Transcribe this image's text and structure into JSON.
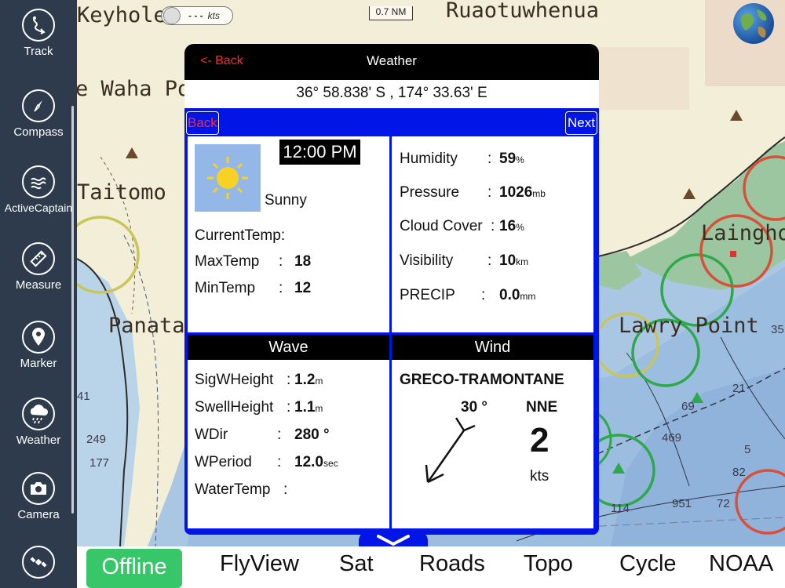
{
  "sidebar": {
    "items": [
      {
        "label": "Track",
        "icon": "track-icon"
      },
      {
        "label": "Compass",
        "icon": "compass-icon"
      },
      {
        "label": "ActiveCaptain",
        "icon": "activecaptain-icon"
      },
      {
        "label": "Measure",
        "icon": "ruler-icon"
      },
      {
        "label": "Marker",
        "icon": "map-pin-icon"
      },
      {
        "label": "Weather",
        "icon": "cloud-rain-icon"
      },
      {
        "label": "Camera",
        "icon": "camera-icon"
      },
      {
        "label": "",
        "icon": "satellite-icon"
      }
    ]
  },
  "map": {
    "place_labels": [
      "Keyhole",
      "Ruaotuwhenua",
      "e Waha Po",
      "Taitomo",
      "Panata",
      "Laingho",
      "Lawry Point"
    ],
    "depths": [
      "21",
      "69",
      "469",
      "5",
      "82",
      "114",
      "951",
      "72",
      "41",
      "249",
      "177",
      "35"
    ],
    "speed": {
      "value": "- - -",
      "unit": "kts"
    },
    "scale": "0.7 NM"
  },
  "dialog": {
    "back_label": "<- Back",
    "title": "Weather",
    "coordinates": "36° 58.838' S , 174° 33.63' E",
    "nav_back": "Back",
    "nav_next": "Next",
    "current": {
      "time": "12:00 PM",
      "condition": "Sunny",
      "condition_icon": "sun-icon",
      "current_temp_label": "CurrentTemp:",
      "max_label": "MaxTemp",
      "max_value": "18",
      "min_label": "MinTemp",
      "min_value": "12"
    },
    "atmosphere": {
      "humidity_label": "Humidity",
      "humidity_value": "59",
      "humidity_unit": "%",
      "pressure_label": "Pressure",
      "pressure_value": "1026",
      "pressure_unit": "mb",
      "cloud_label": "Cloud Cover",
      "cloud_value": "16",
      "cloud_unit": "%",
      "visibility_label": "Visibility",
      "visibility_value": "10",
      "visibility_unit": "km",
      "precip_label": "PRECIP",
      "precip_value": "0.0",
      "precip_unit": "mm"
    },
    "wave": {
      "header": "Wave",
      "sig_label": "SigWHeight",
      "sig_value": "1.2",
      "sig_unit": "m",
      "swell_label": "SwellHeight",
      "swell_value": "1.1",
      "swell_unit": "m",
      "dir_label": "WDir",
      "dir_value": "280 °",
      "period_label": "WPeriod",
      "period_value": "12.0",
      "period_unit": "sec",
      "water_label": "WaterTemp"
    },
    "wind": {
      "header": "Wind",
      "name": "GRECO-TRAMONTANE",
      "degrees": "30 °",
      "direction": "NNE",
      "speed": "2",
      "unit": "kts"
    }
  },
  "bottombar": {
    "tabs": [
      "Offline",
      "FlyView",
      "Sat",
      "Roads",
      "Topo",
      "Cycle",
      "NOAA"
    ],
    "active": "Offline",
    "active_color": "#37c768"
  },
  "colors": {
    "sidebar": "#2d3b4c",
    "dialog_frame": "#0015e6",
    "back_red": "#ff2a2a"
  }
}
